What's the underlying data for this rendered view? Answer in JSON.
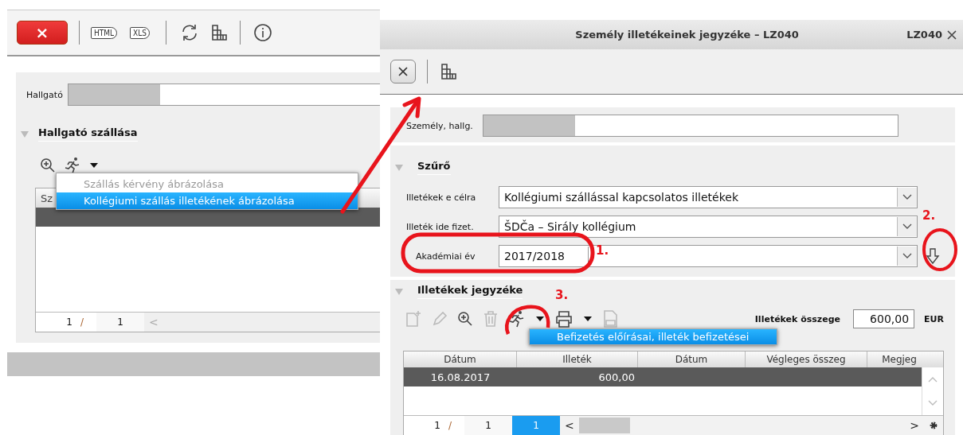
{
  "left_window": {
    "toolbar": [
      {
        "kind": "close",
        "label": "×"
      },
      {
        "kind": "sep"
      },
      {
        "kind": "tag",
        "label": "HTML"
      },
      {
        "kind": "tag",
        "label": "XLS"
      },
      {
        "kind": "sep"
      },
      {
        "kind": "refresh"
      },
      {
        "kind": "grid"
      },
      {
        "kind": "sep"
      },
      {
        "kind": "info"
      }
    ],
    "student_field": {
      "label": "Hallgató"
    },
    "section": {
      "title": "Hallgató szállása",
      "expanded": true
    },
    "tools": [
      {
        "kind": "zoom"
      },
      {
        "kind": "runner"
      },
      {
        "kind": "caret"
      }
    ],
    "menu": [
      {
        "label": "Szállás kérvény ábrázolása",
        "disabled": true,
        "selected": false
      },
      {
        "label": "Kollégiumi szállás illetékének ábrázolása",
        "disabled": false,
        "selected": true
      }
    ],
    "table": {
      "columns": [
        "Sz"
      ]
    },
    "pager": {
      "current": "1",
      "separator": "/",
      "total": "1",
      "prev": "<"
    }
  },
  "right_window": {
    "title": "Személy illetékeinek jegyzéke – LZ040",
    "code": "LZ040",
    "toolbar": [
      {
        "kind": "close"
      },
      {
        "kind": "sep"
      },
      {
        "kind": "grid"
      }
    ],
    "person_field": {
      "label": "Személy, hallg."
    },
    "filter": {
      "title": "Szűrő",
      "expanded": true,
      "rows": [
        {
          "kind": "select",
          "label": "Illetékek e célra",
          "value": "Kollégiumi szállással kapcsolatos illetékek"
        },
        {
          "kind": "select",
          "label": "Illeték ide fizet.",
          "value": "ŠDČa – Sirály kollégium"
        },
        {
          "kind": "year",
          "label": "Akadémiai év",
          "value": "2017/2018"
        }
      ]
    },
    "list": {
      "title": "Illetékek jegyzéke",
      "expanded": true,
      "tools": [
        {
          "kind": "new",
          "disabled": true
        },
        {
          "kind": "pencil",
          "disabled": true
        },
        {
          "kind": "zoom",
          "disabled": false
        },
        {
          "kind": "trash",
          "disabled": true
        },
        {
          "kind": "runner",
          "disabled": false
        },
        {
          "kind": "caret",
          "disabled": false
        },
        {
          "kind": "printer",
          "disabled": false
        },
        {
          "kind": "caret",
          "disabled": false
        },
        {
          "kind": "log",
          "disabled": true
        }
      ],
      "total": {
        "label": "Illetékek összege",
        "value": "600,00",
        "currency": "EUR"
      },
      "menu": [
        {
          "label": "Befizetés előírásai, illeték befizetései",
          "selected": true
        }
      ],
      "table": {
        "columns": [
          "Dátum",
          "Illeték",
          "Dátum",
          "Végleges összeg",
          "Megjeg"
        ],
        "rows": [
          {
            "cells": [
              "16.08.2017",
              "600,00",
              "",
              "",
              ""
            ],
            "selected": true
          }
        ]
      },
      "pager": {
        "current": "1",
        "separator": "/",
        "total": "1",
        "page": "1",
        "prev": "<",
        "next": ">"
      }
    }
  },
  "annotations": [
    {
      "kind": "arrow"
    },
    {
      "kind": "ellipse",
      "label": "1."
    },
    {
      "kind": "circle",
      "label": "2."
    },
    {
      "kind": "arc",
      "label": "3."
    }
  ]
}
